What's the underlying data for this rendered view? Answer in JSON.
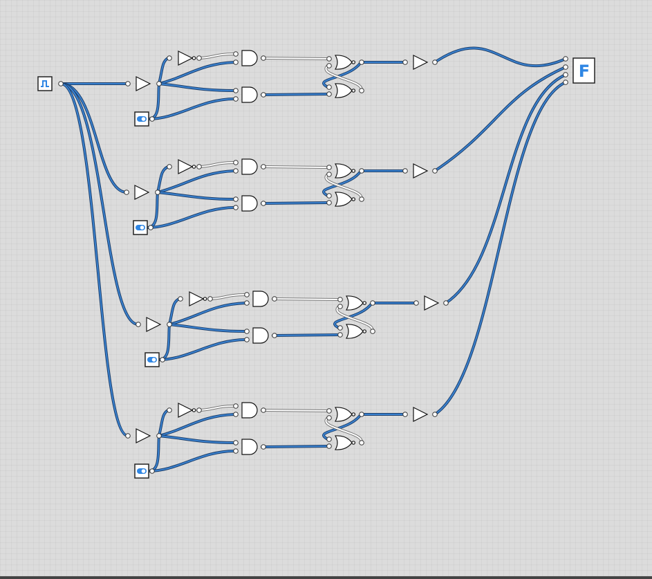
{
  "canvas": {
    "title": ""
  },
  "components": {
    "clock": {
      "icon": "clock-square-wave-icon"
    },
    "switches": {
      "icon": "toggle-switch-icon",
      "count": 4
    },
    "output": {
      "label": "F",
      "icon": "output-display-icon"
    }
  },
  "stages": [
    {
      "name": "stage-1",
      "gates": [
        "buffer",
        "not",
        "and",
        "and",
        "nor",
        "nor",
        "buffer"
      ]
    },
    {
      "name": "stage-2",
      "gates": [
        "buffer",
        "not",
        "and",
        "and",
        "nor",
        "nor",
        "buffer"
      ]
    },
    {
      "name": "stage-3",
      "gates": [
        "buffer",
        "not",
        "and",
        "and",
        "nor",
        "nor",
        "buffer"
      ]
    },
    {
      "name": "stage-4",
      "gates": [
        "buffer",
        "not",
        "and",
        "and",
        "nor",
        "nor",
        "buffer"
      ]
    }
  ],
  "colors": {
    "wire_active": "#3a82d0",
    "wire_inactive": "#ffffff",
    "accent": "#2f86e4"
  }
}
